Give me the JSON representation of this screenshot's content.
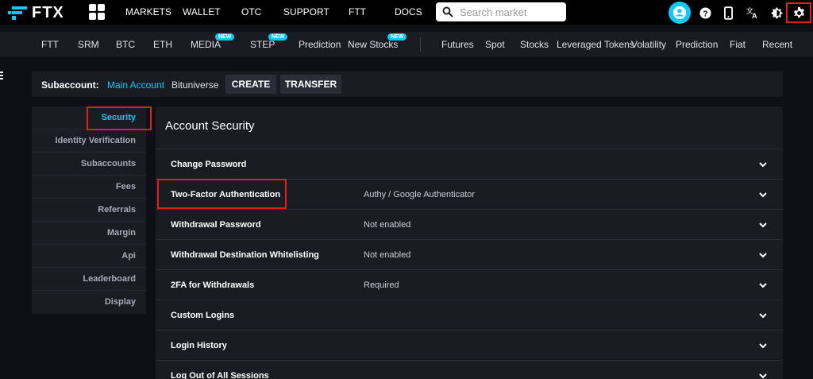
{
  "topbar": {
    "logo_text": "FTX",
    "nav": [
      "MARKETS",
      "WALLET",
      "OTC",
      "SUPPORT",
      "FTT",
      "DOCS"
    ],
    "search_placeholder": "Search market",
    "icons": [
      "user-icon",
      "help-icon",
      "mobile-icon",
      "translate-icon",
      "theme-icon",
      "gear-icon"
    ]
  },
  "subnav": {
    "left_items": [
      {
        "label": "FTT"
      },
      {
        "label": "SRM"
      },
      {
        "label": "BTC"
      },
      {
        "label": "ETH"
      },
      {
        "label": "MEDIA",
        "badge": "NEW"
      },
      {
        "label": "STEP",
        "badge": "NEW"
      },
      {
        "label": "Prediction"
      },
      {
        "label": "New Stocks",
        "badge": "NEW"
      }
    ],
    "right_items": [
      "Futures",
      "Spot",
      "Stocks",
      "Leveraged Tokens",
      "Volatility",
      "Prediction",
      "Fiat",
      "Recent"
    ]
  },
  "subaccount": {
    "label": "Subaccount:",
    "main": "Main Account",
    "other": "Bituniverse",
    "create_label": "CREATE",
    "transfer_label": "TRANSFER"
  },
  "sidebar": {
    "items": [
      "Security",
      "Identity Verification",
      "Subaccounts",
      "Fees",
      "Referrals",
      "Margin",
      "Api",
      "Leaderboard",
      "Display"
    ],
    "active": "Security"
  },
  "main": {
    "title": "Account Security",
    "rows": [
      {
        "name": "Change Password",
        "value": ""
      },
      {
        "name": "Two-Factor Authentication",
        "value": "Authy / Google Authenticator"
      },
      {
        "name": "Withdrawal Password",
        "value": "Not enabled"
      },
      {
        "name": "Withdrawal Destination Whitelisting",
        "value": "Not enabled"
      },
      {
        "name": "2FA for Withdrawals",
        "value": "Required"
      },
      {
        "name": "Custom Logins",
        "value": ""
      },
      {
        "name": "Login History",
        "value": ""
      },
      {
        "name": "Log Out of All Sessions",
        "value": ""
      }
    ]
  },
  "colors": {
    "accent": "#11c8f4",
    "highlight_box": "#e0201f",
    "background": "#0f1016",
    "panel": "#1a1c24"
  }
}
